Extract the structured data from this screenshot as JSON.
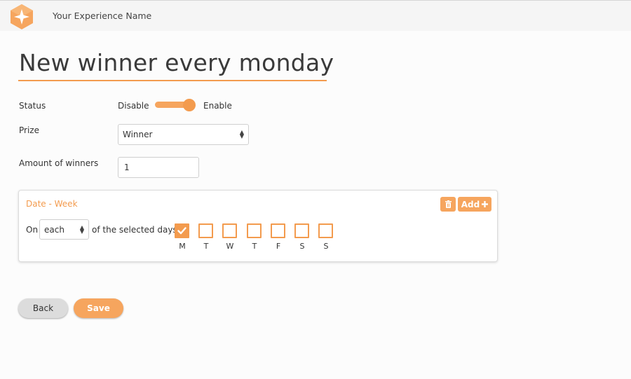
{
  "header": {
    "app_name": "Your Experience Name"
  },
  "page": {
    "title": "New winner every monday"
  },
  "form": {
    "status": {
      "label": "Status",
      "off_label": "Disable",
      "on_label": "Enable",
      "enabled": true
    },
    "prize": {
      "label": "Prize",
      "selected": "Winner"
    },
    "winners": {
      "label": "Amount of winners",
      "value": "1"
    }
  },
  "schedule": {
    "title": "Date - Week",
    "add_label": "Add",
    "prefix": "On",
    "frequency_selected": "each",
    "suffix": "of the selected days",
    "days": [
      {
        "label": "M",
        "checked": true
      },
      {
        "label": "T",
        "checked": false
      },
      {
        "label": "W",
        "checked": false
      },
      {
        "label": "T",
        "checked": false
      },
      {
        "label": "F",
        "checked": false
      },
      {
        "label": "S",
        "checked": false
      },
      {
        "label": "S",
        "checked": false
      }
    ]
  },
  "actions": {
    "back_label": "Back",
    "save_label": "Save"
  },
  "colors": {
    "accent": "#f39b4e",
    "accent_light": "#f6a55e",
    "neutral_button": "#dcdcdc"
  },
  "icons": {
    "logo": "diamond-star-logo",
    "delete": "trash-icon",
    "add": "plus-icon",
    "check": "checkmark-icon",
    "select": "updown-chevron-icon"
  }
}
